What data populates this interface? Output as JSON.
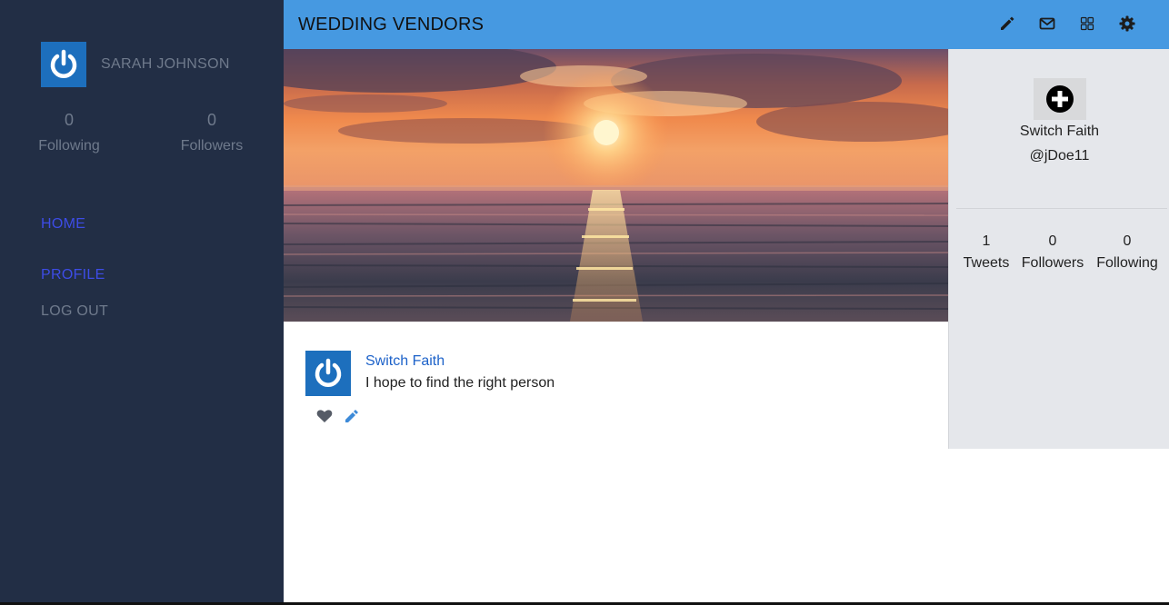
{
  "sidebar": {
    "username": "SARAH JOHNSON",
    "following_count": "0",
    "following_label": "Following",
    "followers_count": "0",
    "followers_label": "Followers",
    "nav": {
      "home": "HOME",
      "profile": "PROFILE",
      "logout": "LOG OUT"
    }
  },
  "header": {
    "title": "WEDDING VENDORS",
    "icons": [
      "pencil-icon",
      "mail-icon",
      "grid-icon",
      "gear-icon"
    ]
  },
  "tweet": {
    "author": "Switch Faith",
    "text": "I hope to find the right person"
  },
  "profile_panel": {
    "name": "Switch Faith",
    "handle": "@jDoe11",
    "tweets_count": "1",
    "tweets_label": "Tweets",
    "followers_count": "0",
    "followers_label": "Followers",
    "following_count": "0",
    "following_label": "Following"
  },
  "colors": {
    "sidebar_bg": "#222e45",
    "header_bg": "#4699e1",
    "accent_link": "#3d4ce6",
    "avatar_bg": "#1d6fbd",
    "panel_bg": "#e5e7eb"
  }
}
